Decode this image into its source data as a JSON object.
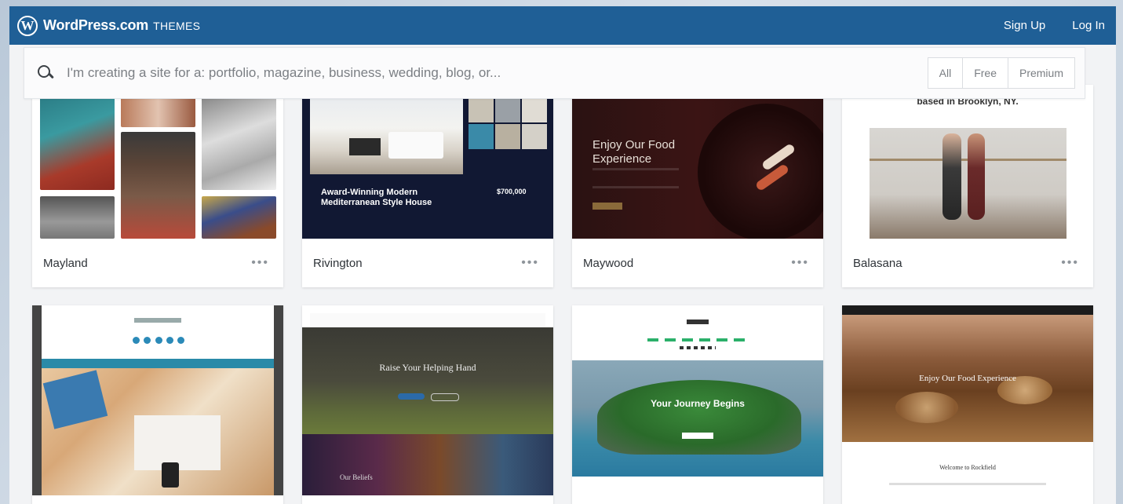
{
  "header": {
    "brand": "WordPress.com",
    "section": "THEMES",
    "links": [
      "Sign Up",
      "Log In"
    ]
  },
  "search": {
    "placeholder": "I'm creating a site for a: portfolio, magazine, business, wedding, blog, or...",
    "filters": [
      "All",
      "Free",
      "Premium"
    ]
  },
  "themes": [
    {
      "name": "Mayland",
      "more": "•••"
    },
    {
      "name": "Rivington",
      "more": "•••",
      "preview_title": "Award-Winning Modern\nMediterranean Style House",
      "preview_price": "$700,000"
    },
    {
      "name": "Maywood",
      "more": "•••",
      "preview_title": "Enjoy Our Food Experience"
    },
    {
      "name": "Balasana",
      "more": "•••",
      "preview_caption": "based in Brooklyn, NY."
    },
    {
      "name": "",
      "preview_title": ""
    },
    {
      "name": "",
      "preview_title": "Raise Your Helping Hand",
      "preview_sub": "Our Beliefs"
    },
    {
      "name": "",
      "preview_title": "Your Journey Begins"
    },
    {
      "name": "",
      "preview_title": "Enjoy Our Food Experience",
      "preview_sub": "Welcome to Rockfield"
    }
  ],
  "colors": {
    "masthead": "#1f5f96",
    "accent_blue": "#2b8ab8"
  }
}
